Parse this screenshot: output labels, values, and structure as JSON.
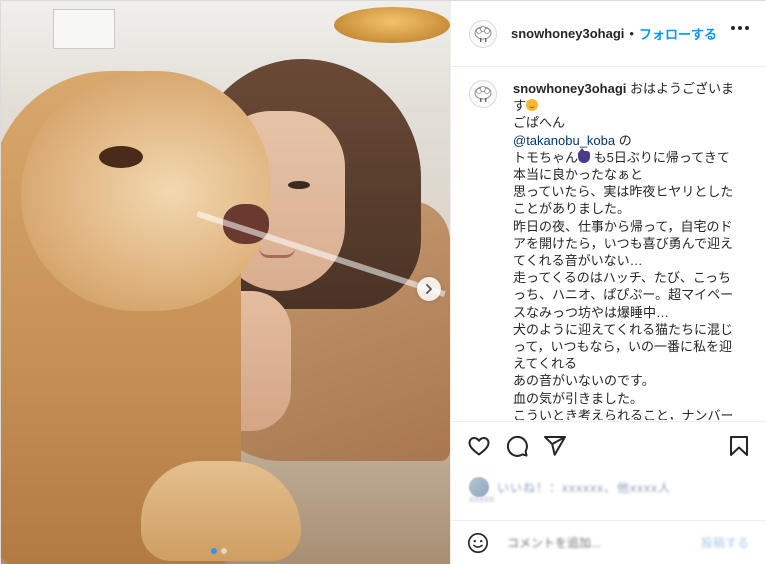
{
  "post": {
    "username": "snowhoney3ohagi",
    "separator": "•",
    "follow_label": "フォローする",
    "more_icon": "more-horizontal-icon",
    "avatar_icon": "sheep-avatar-icon"
  },
  "photo": {
    "next_icon": "chevron-right-icon",
    "slide_count": 2,
    "active_slide": 1
  },
  "caption": {
    "username": "snowhoney3ohagi",
    "greeting": "おはようございます",
    "greeting_emoji": "smiling-face-emoji",
    "line2": "ごぱへん",
    "mention": "@takanobu_koba",
    "mention_suffix": " の",
    "line4a": "トモちゃん",
    "line4_emoji": "black-cat-emoji",
    "line4b": " も5日ぶりに帰ってきて本当に良かったなぁと",
    "lines": [
      "思っていたら、実は昨夜ヒヤリとしたことがありました。",
      "昨日の夜、仕事から帰って，自宅のドアを開けたら，いつも喜び勇んで迎えてくれる音がいない…",
      "走ってくるのはハッチ、たび、こっちっち、ハニオ、ぱぴぷー。超マイペースなみっつ坊やは爆睡中…",
      "犬のように迎えてくれる猫たちに混じって，いつもなら，いの一番に私を迎えてくれる",
      "あの音がいないのです。",
      "血の気が引きました。",
      "こういとき考えられること，ナンバー"
    ]
  },
  "actions": {
    "like_icon": "heart-icon",
    "comment_icon": "comment-icon",
    "share_icon": "send-icon",
    "save_icon": "bookmark-icon"
  },
  "likes": {
    "text": "いいね！：xxxxxx、他xxxx人",
    "sub": "xxxxx"
  },
  "comment": {
    "emoji_icon": "emoji-smiley-icon",
    "placeholder": "コメントを追加...",
    "post_label": "投稿する"
  },
  "colors": {
    "accent": "#0095f6",
    "mention": "#00376b",
    "text": "#262626",
    "divider": "#efefef"
  }
}
